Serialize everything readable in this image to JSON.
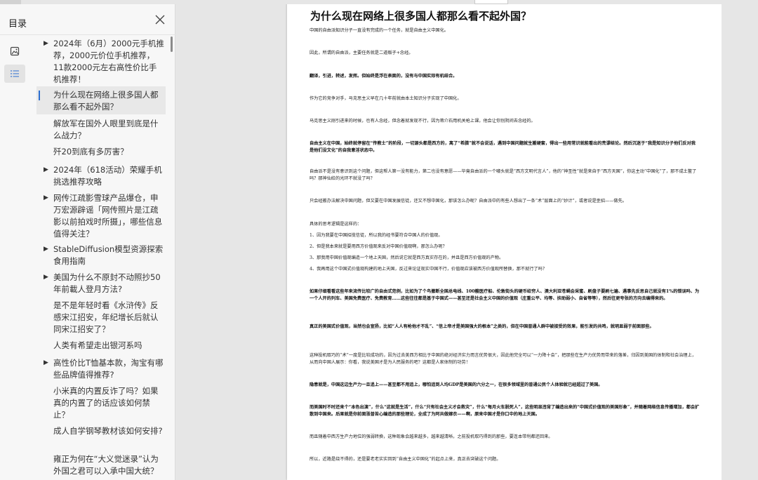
{
  "sidebar": {
    "title": "目录",
    "toc": [
      {
        "label": "2024年（6月）2000元手机推荐，2000元价位手机推荐，11款2000元左右高性价比手机推荐！",
        "arrow": true
      },
      {
        "label": "为什么现在网络上很多国人都那么看不起外国？",
        "arrow": false,
        "current": true
      },
      {
        "label": "解放军在国外人眼里到底是什么战力？",
        "arrow": false
      },
      {
        "label": "歼20到底有多厉害？",
        "arrow": false
      },
      {
        "label": "2024年（618活动）荣耀手机挑选推荐攻略",
        "arrow": true
      },
      {
        "label": "网传江疏影雪球产品爆仓，申万宏源辟谣「网传照片是江疏影以前拍戏时所摄」，哪些信息值得关注？",
        "arrow": true
      },
      {
        "label": "StableDiffusion模型资源探索食用指南",
        "arrow": true
      },
      {
        "label": "美国为什么不原封不动照抄50年前載人登月方法?",
        "arrow": true
      },
      {
        "label": "是不是年轻时看《水浒传》反感宋江招安，年纪增长后就认同宋江招安了？",
        "arrow": false
      },
      {
        "label": "人类有希望走出银河系吗",
        "arrow": false
      },
      {
        "label": "高性价比T恤基本款，淘宝有哪些品牌值得推荐?",
        "arrow": true
      },
      {
        "label": "小米真的内置反诈了吗？如果真的内置了的话应该如何禁止？",
        "arrow": false
      },
      {
        "label": "成人自学钢琴教材该如何安排?",
        "arrow": false
      },
      {
        "label": "雍正为何在“大义觉迷录”认为外国之君可以入承中国大统？",
        "arrow": false
      }
    ]
  },
  "document": {
    "title": "为什么现在网络上很多国人都那么看不起外国？",
    "paragraphs": [
      {
        "text": "中国的自由派知识分子一直没有完成的一个任务，就是自由主义中国化。",
        "bold": false
      },
      {
        "text": "因此，所谓的自由派，主要任务就是二道贩子+念经。",
        "bold": false
      },
      {
        "text": "翻译，引进，转述，发挥。但始终是浮在表面的，没有与中国实际有机结合。",
        "bold": false
      },
      {
        "text": "作为它的竞争对手，马克思主义早在几十年前就由本土知识分子实现了中国化。",
        "bold": false
      },
      {
        "text": "马克思主义刚引进来的时候，也有人念经，但念着就发现不行，因为蒋介石用机关枪上课，他会让你别阴间去念经的。",
        "bold": false
      },
      {
        "text": "自由主义在中国，始终就停留在“传教士”的阶段，一切源头都是西方的，离了“希腊”就不会说话，遇到中国问题就生搬硬套，得出一些用常识就能看出的荒谬结论。然后沉迷于“我是知识分子他们反对我是他们没文化”的自我意淫状态中。",
        "bold": true
      },
      {
        "text": "自由派不是没有意识到这个问题，但这帮人第一没有能力，第二也没有意愿——毕竟自由派的一个噱头就是“西方文明代言人”，他的“神圣性”就是来自于“西方天国”，你这主动“中国化”了，那不成土鳖了吗？那神仙给的光环不就没了吗？",
        "bold": false
      },
      {
        "text": "只会经搬办法解决中国问题，但又要在中国发展信徒，还又不想中国化，那该怎么办呢？自由派中的有些人想出了一条“术”层面上的“妙计”，或者说是歪招——做先。",
        "bold": false
      },
      {
        "text": "具体的思考逻辑是这样的：",
        "bold": false
      },
      {
        "text": "1、因为我要在中国招揽信徒，所以我的经书要符合中国人的价值观。",
        "bold": false
      },
      {
        "text": "2、但是我本来就是要用西方价值观来反对中国价值观啊，那怎么办呢？",
        "bold": false
      },
      {
        "text": "3、那我用中国价值观编造一个地上天国，然后说它就是西方真实存在的，并且是西方价值观的产物。",
        "bold": false
      },
      {
        "text": "4、我再用这个中国式价值观构建的地上天国，反过来论证现实中国不行，价值观应该被西方价值观所替换，那不就行了吗？",
        "bold": false
      },
      {
        "text": "如果仔细看看这些年来流传比较广的自由式范例，比如为了个鸟撤断全国总电线、100艘医疗船、伦敦街头的硬币给穷人、澳大利亚苍蝇会采蜜、刷盘子要刷七遍、遇事先反思自己就没有1%的错误吗、为一个人开的列车、美国免费医疗、免费教育……这些往往都是基于中国式——甚至还是社会主义中国的价值观（庄重公平、均等、扶助弱小、自省等等），然后往更夸张的方向去编得来的。",
        "bold": true
      },
      {
        "text": "真正的美国式价值观，当然也会宣扬，比如“人人有枪他才不乱”、“信上帝才是美国强大的根本”之类的，但在中国普通人群中被接受的效果，能引发的共鸣，就明显弱于前面那些。",
        "bold": true
      },
      {
        "text": "这种投机取巧的“术”一度是比较成功的，因为过去美西方相比于中国的绝对经济实力而言优势很大，因此他完全可以“一力降十会”，把那些在生产力优势而带来的落差，归因到美国的体制和社会治理上，从而向中国人展示：你看，我说美国才是为人民服务的吧？这都是人家体制的功劳！",
        "bold": false
      },
      {
        "text": "隐患就是，中国这边生产力一旦追上——甚至都不用追上，哪怕追到人均GDP是美国的六分之一，在很多领域里的普通公民个人体验就已经超过了美国。",
        "bold": true
      },
      {
        "text": "而美国时不时还来个“本色出演”，什么“这就是生活”，什么“只有社会主义才会救灾”，什么“每月火车脱死人”，这些明显违背了编造出来的“中国式价值观的美国形象”，并随着网络信息传播增加，都会扩散到中国来。后果就是你前面涨普苦心编造的那些理论，全成了为阿共做嫁衣——啊，原来中国才是你口中的地上天国。",
        "bold": true
      },
      {
        "text": "而且随着中西方生产力地位的强弱转换，这种现象会越来越多，越来越清晰，之前投机取巧得到的那些，要连本带利都还回来。",
        "bold": false
      },
      {
        "text": "所以，近路是绕不得的，还是要老老实实回到“自由主义中国化”的起点上来，真正去突破这个问题。",
        "bold": false
      }
    ]
  }
}
